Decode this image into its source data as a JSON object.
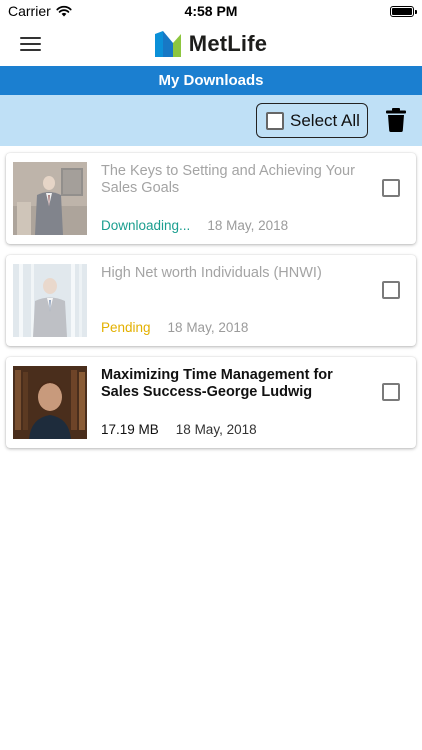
{
  "status_bar": {
    "carrier": "Carrier",
    "time": "4:58 PM"
  },
  "header": {
    "brand": "MetLife",
    "menu_icon": "hamburger-menu-icon"
  },
  "page": {
    "title": "My Downloads"
  },
  "toolbar": {
    "select_all_label": "Select All",
    "select_all_checked": false,
    "delete_icon": "trash-icon"
  },
  "downloads": [
    {
      "title": "The Keys to Setting and Achieving Your Sales Goals",
      "status": "Downloading...",
      "date": "18 May, 2018",
      "checked": false
    },
    {
      "title": "High Net worth Individuals (HNWI)",
      "status": "Pending",
      "date": "18 May, 2018",
      "checked": false
    },
    {
      "title": "Maximizing Time Management for Sales Success-George Ludwig",
      "status": "17.19 MB",
      "date": "18 May, 2018",
      "checked": false
    }
  ],
  "colors": {
    "title_bar": "#1b7fd0",
    "toolbar_bg": "#bfe0f6",
    "downloading": "#1a9e8f",
    "pending": "#e3b000",
    "logo_blue": "#0b90d8",
    "logo_green": "#8dc63f"
  }
}
